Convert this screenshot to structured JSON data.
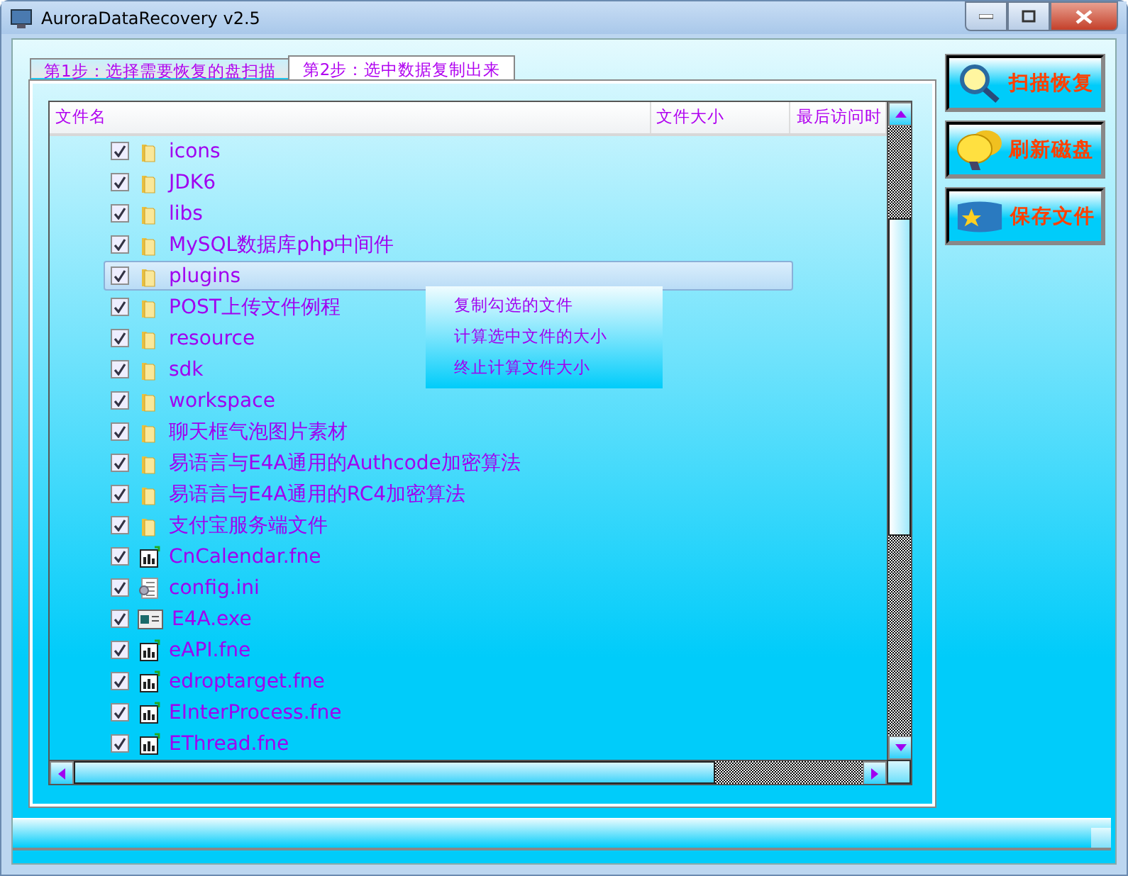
{
  "window": {
    "title": "AuroraDataRecovery v2.5"
  },
  "tabs": [
    {
      "label": "第1步：选择需要恢复的盘扫描",
      "selected": false
    },
    {
      "label": "第2步：选中数据复制出来",
      "selected": true
    }
  ],
  "table": {
    "columns": [
      "文件名",
      "文件大小",
      "最后访问时"
    ],
    "rows": [
      {
        "name": "icons",
        "kind": "folder",
        "checked": true,
        "selected": false
      },
      {
        "name": "JDK6",
        "kind": "folder",
        "checked": true,
        "selected": false
      },
      {
        "name": "libs",
        "kind": "folder",
        "checked": true,
        "selected": false
      },
      {
        "name": "MySQL数据库php中间件",
        "kind": "folder",
        "checked": true,
        "selected": false
      },
      {
        "name": "plugins",
        "kind": "folder",
        "checked": true,
        "selected": true
      },
      {
        "name": "POST上传文件例程",
        "kind": "folder",
        "checked": true,
        "selected": false
      },
      {
        "name": "resource",
        "kind": "folder",
        "checked": true,
        "selected": false
      },
      {
        "name": "sdk",
        "kind": "folder",
        "checked": true,
        "selected": false
      },
      {
        "name": "workspace",
        "kind": "folder",
        "checked": true,
        "selected": false
      },
      {
        "name": "聊天框气泡图片素材",
        "kind": "folder",
        "checked": true,
        "selected": false
      },
      {
        "name": "易语言与E4A通用的Authcode加密算法",
        "kind": "folder",
        "checked": true,
        "selected": false
      },
      {
        "name": "易语言与E4A通用的RC4加密算法",
        "kind": "folder",
        "checked": true,
        "selected": false
      },
      {
        "name": "支付宝服务端文件",
        "kind": "folder",
        "checked": true,
        "selected": false
      },
      {
        "name": "CnCalendar.fne",
        "kind": "fne",
        "checked": true,
        "selected": false
      },
      {
        "name": "config.ini",
        "kind": "ini",
        "checked": true,
        "selected": false
      },
      {
        "name": "E4A.exe",
        "kind": "exe",
        "checked": true,
        "selected": false
      },
      {
        "name": "eAPI.fne",
        "kind": "fne",
        "checked": true,
        "selected": false
      },
      {
        "name": "edroptarget.fne",
        "kind": "fne",
        "checked": true,
        "selected": false
      },
      {
        "name": "EInterProcess.fne",
        "kind": "fne",
        "checked": true,
        "selected": false
      },
      {
        "name": "EThread.fne",
        "kind": "fne",
        "checked": true,
        "selected": false
      }
    ]
  },
  "context_menu": {
    "items": [
      "复制勾选的文件",
      "计算选中文件的大小",
      "终止计算文件大小"
    ]
  },
  "buttons": [
    {
      "label": "扫描恢复",
      "kind": "scan"
    },
    {
      "label": "刷新磁盘",
      "kind": "refresh"
    },
    {
      "label": "保存文件",
      "kind": "save"
    }
  ]
}
